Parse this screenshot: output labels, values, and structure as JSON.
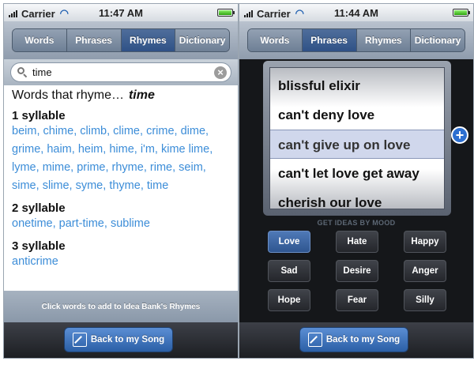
{
  "left": {
    "status": {
      "carrier": "Carrier",
      "time": "11:47 AM"
    },
    "tabs": [
      {
        "label": "Words"
      },
      {
        "label": "Phrases"
      },
      {
        "label": "Rhymes"
      },
      {
        "label": "Dictionary"
      }
    ],
    "active_tab": "Rhymes",
    "search": {
      "value": "time"
    },
    "heading": {
      "prefix": "Words that rhyme…",
      "word": "time"
    },
    "groups": [
      {
        "title": "1 syllable",
        "words": [
          "beim",
          "chime",
          "climb",
          "clime",
          "crime",
          "dime",
          "grime",
          "haim",
          "heim",
          "hime",
          "i'm",
          "kime lime",
          "lyme",
          "mime",
          "prime",
          "rhyme",
          "rime",
          "seim",
          "sime",
          "slime",
          "syme",
          "thyme",
          "time"
        ]
      },
      {
        "title": "2 syllable",
        "words": [
          "onetime",
          "part-time",
          "sublime"
        ]
      },
      {
        "title": "3 syllable",
        "words": [
          "anticrime"
        ]
      }
    ],
    "hint": "Click words to add to Idea Bank's Rhymes",
    "back_button": "Back to my Song"
  },
  "right": {
    "status": {
      "carrier": "Carrier",
      "time": "11:44 AM"
    },
    "tabs": [
      {
        "label": "Words"
      },
      {
        "label": "Phrases"
      },
      {
        "label": "Rhymes"
      },
      {
        "label": "Dictionary"
      }
    ],
    "active_tab": "Phrases",
    "picker": [
      "blissful elixir",
      "can't deny love",
      "can't give up on love",
      "can't let love get away",
      "cherish our love"
    ],
    "picker_selected": "can't give up on love",
    "mood_title": "GET IDEAS BY MOOD",
    "moods": [
      "Love",
      "Hate",
      "Happy",
      "Sad",
      "Desire",
      "Anger",
      "Hope",
      "Fear",
      "Silly"
    ],
    "mood_selected": "Love",
    "back_button": "Back to my Song"
  },
  "icons": [
    "signal-icon",
    "wifi-icon",
    "battery-icon",
    "search-icon",
    "clear-icon",
    "pencil-icon",
    "add-icon"
  ],
  "colors": {
    "accent": "#2f5186",
    "link": "#3c8dd8",
    "selected_mood": "#3d68a6"
  }
}
